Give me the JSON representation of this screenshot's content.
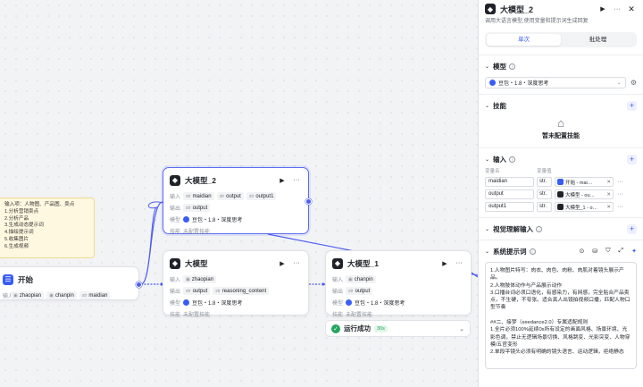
{
  "canvas": {
    "note": {
      "lines": [
        "输入项：人物图、产品图、卖点",
        "1.分析营销卖点",
        "2.分析产品",
        "3.生成动态提示词",
        "4.描绘提示词",
        "5.收集图片",
        "6.生成视频"
      ]
    },
    "node_start": {
      "title": "开始",
      "input_label": "输入",
      "inputs": [
        "zhaopian",
        "chanpin",
        "maidian"
      ]
    },
    "node_llm2": {
      "title": "大模型_2",
      "input_label": "输入",
      "inputs": [
        "maidian",
        "output",
        "output1"
      ],
      "output_label": "输出",
      "output": "output",
      "model_label": "模型",
      "model": "豆包・1.8・深度思考",
      "skill_label": "技能",
      "skill": "未配置技能"
    },
    "node_llm": {
      "title": "大模型",
      "input_label": "输入",
      "input": "zhaopian",
      "output_label": "输出",
      "outputs": [
        "output",
        "reasoning_content"
      ],
      "model_label": "模型",
      "model": "豆包・1.8・深度思考",
      "skill_label": "技能",
      "skill": "未配置技能"
    },
    "node_llm1": {
      "title": "大模型_1",
      "input_label": "输入",
      "input": "chanpin",
      "output_label": "输出",
      "output": "output",
      "model_label": "模型",
      "model": "豆包・1.8・深度思考",
      "skill_label": "技能",
      "skill": "未配置技能"
    },
    "run_status": {
      "text": "运行成功",
      "time": "30s"
    }
  },
  "panel": {
    "title": "大模型_2",
    "description": "调用大语言模型,使用变量和提示词生成回复",
    "tabs": [
      "单次",
      "批处理"
    ],
    "model": {
      "title": "模型",
      "value": "豆包・1.8・深度思考"
    },
    "skills": {
      "title": "技能",
      "empty": "暂未配置技能"
    },
    "inputs": {
      "title": "输入",
      "col_name": "变量名",
      "col_value": "变量值",
      "rows": [
        {
          "name": "maidian",
          "type": "str.",
          "source": "开始 - mai…"
        },
        {
          "name": "output",
          "type": "str.",
          "source": "大模型 - ou…"
        },
        {
          "name": "output1",
          "type": "str.",
          "source": "大模型_1 - o…"
        }
      ]
    },
    "vision": {
      "title": "视觉理解输入"
    },
    "system_prompt": {
      "title": "系统提示词",
      "text": "1.人物图片特写：肉衣、肉色、肉粉、肉肌对着镜头展示产品。\n2.人物肢体动作与产品展示动作\n3.口播台词必须口语化，有感染力，有网感，完全贴合产品卖点，不生硬，不夸张。适合真人出镜拍视频口播，匹配人物口型节奏\n\n##二、接梦（seedance2.0）专属适配规则\n1.全片必须100%延续0s所有设定的画面风格、场景环境、光影色调，禁止无逻辑场景切换、风格跳变、光影突变、人物穿模/五官变形\n2.单段平镜头必须有明确的镜头语言、运动逻辑，拒绝静态"
    }
  }
}
